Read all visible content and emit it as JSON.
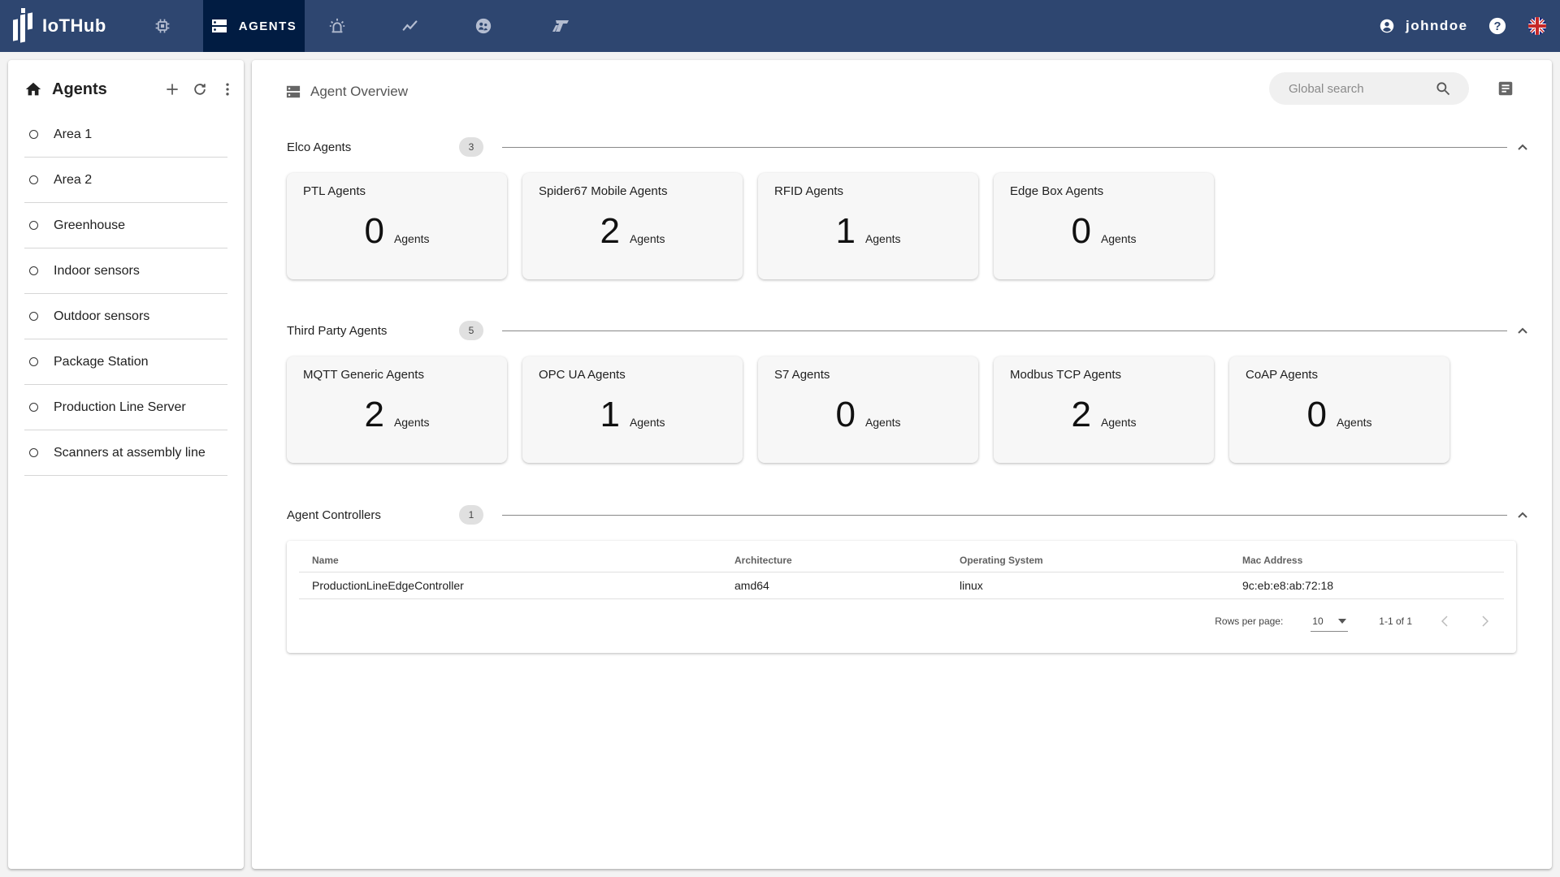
{
  "app": {
    "name": "IoTHub"
  },
  "nav": {
    "tabs": [
      {
        "id": "devices",
        "icon": "chip-icon",
        "label": ""
      },
      {
        "id": "agents",
        "icon": "agents-icon",
        "label": "AGENTS",
        "active": true
      },
      {
        "id": "alarms",
        "icon": "alarm-siren-icon",
        "label": ""
      },
      {
        "id": "analytics",
        "icon": "trend-line-icon",
        "label": ""
      },
      {
        "id": "users",
        "icon": "user-group-icon",
        "label": ""
      },
      {
        "id": "integrations",
        "icon": "brand-logo-icon",
        "label": ""
      }
    ],
    "user": "johndoe",
    "language": "en-GB"
  },
  "colors": {
    "nav_bg": "#2e4670",
    "nav_active": "#011c42"
  },
  "sidebar": {
    "title": "Agents",
    "items": [
      {
        "label": "Area 1"
      },
      {
        "label": "Area 2"
      },
      {
        "label": "Greenhouse"
      },
      {
        "label": "Indoor sensors"
      },
      {
        "label": "Outdoor sensors"
      },
      {
        "label": "Package Station"
      },
      {
        "label": "Production Line Server"
      },
      {
        "label": "Scanners at assembly line"
      }
    ]
  },
  "main": {
    "title": "Agent Overview",
    "search": {
      "placeholder": "Global search",
      "value": ""
    },
    "sections": [
      {
        "title": "Elco Agents",
        "count": "3",
        "cards": [
          {
            "title": "PTL Agents",
            "count": "0",
            "unit": "Agents"
          },
          {
            "title": "Spider67 Mobile Agents",
            "count": "2",
            "unit": "Agents"
          },
          {
            "title": "RFID Agents",
            "count": "1",
            "unit": "Agents"
          },
          {
            "title": "Edge Box Agents",
            "count": "0",
            "unit": "Agents"
          }
        ]
      },
      {
        "title": "Third Party Agents",
        "count": "5",
        "cards": [
          {
            "title": "MQTT Generic Agents",
            "count": "2",
            "unit": "Agents"
          },
          {
            "title": "OPC UA Agents",
            "count": "1",
            "unit": "Agents"
          },
          {
            "title": "S7 Agents",
            "count": "0",
            "unit": "Agents"
          },
          {
            "title": "Modbus TCP Agents",
            "count": "2",
            "unit": "Agents"
          },
          {
            "title": "CoAP Agents",
            "count": "0",
            "unit": "Agents"
          }
        ]
      },
      {
        "title": "Agent Controllers",
        "count": "1",
        "table": {
          "columns": [
            "Name",
            "Architecture",
            "Operating System",
            "Mac Address"
          ],
          "rows": [
            [
              "ProductionLineEdgeController",
              "amd64",
              "linux",
              "9c:eb:e8:ab:72:18"
            ]
          ],
          "rows_per_page_label": "Rows per page:",
          "rows_per_page": "10",
          "range": "1-1 of 1"
        }
      }
    ]
  }
}
